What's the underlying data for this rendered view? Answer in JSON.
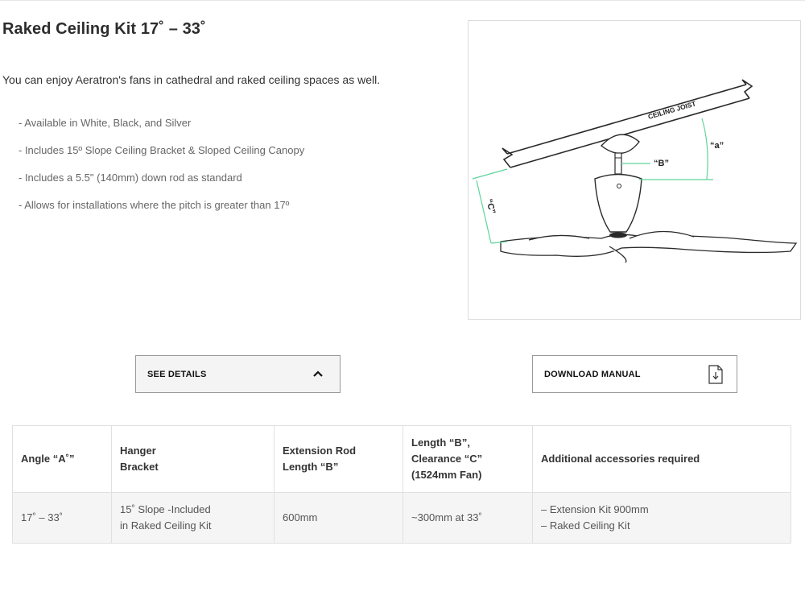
{
  "product": {
    "title": "Raked Ceiling Kit 17˚ – 33˚",
    "intro": "You can enjoy Aeratron's fans in cathedral and raked ceiling spaces as well.",
    "features": [
      "-  Available in White, Black, and Silver",
      "- Includes 15º Slope Ceiling Bracket & Sloped Ceiling Canopy",
      "- Includes a 5.5\" (140mm) down rod as standard",
      "- Allows for installations where the pitch is greater than 17º"
    ]
  },
  "diagram": {
    "joist_label": "CEILING JOIST",
    "label_a": "“a”",
    "label_b": "“B”",
    "label_c": "“C”"
  },
  "buttons": {
    "details_label": "SEE DETAILS",
    "details_icon": "chevron-up-icon",
    "manual_label": "DOWNLOAD MANUAL",
    "manual_icon": "download-document-icon"
  },
  "table": {
    "headers": [
      [
        "Angle “A˚”"
      ],
      [
        "Hanger",
        "Bracket"
      ],
      [
        "Extension Rod",
        "Length “B”"
      ],
      [
        "Length “B”,",
        "Clearance “C”",
        "(1524mm Fan)"
      ],
      [
        "Additional accessories required"
      ]
    ],
    "rows": [
      [
        [
          "17˚ – 33˚"
        ],
        [
          "15˚ Slope -Included",
          "in Raked Ceiling Kit"
        ],
        [
          "600mm"
        ],
        [
          "~300mm at 33˚"
        ],
        [
          "– Extension Kit 900mm",
          "– Raked Ceiling Kit"
        ]
      ]
    ]
  },
  "colors": {
    "accent_green": "#5fd39a",
    "line_dark": "#2a2a2a"
  }
}
